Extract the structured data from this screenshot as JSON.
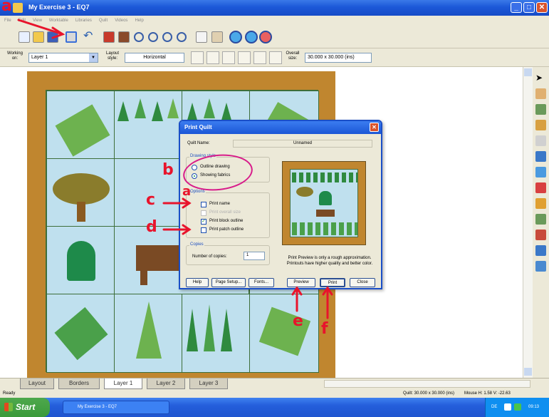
{
  "window": {
    "title": "My Exercise 3 - EQ7",
    "minimize": "_",
    "maximize": "□",
    "close": "✕"
  },
  "menu": [
    "File",
    "Edit",
    "View",
    "Worktable",
    "Libraries",
    "Quilt",
    "Videos",
    "Help"
  ],
  "toolbar2": {
    "working_on_label": "Working on:",
    "working_on_value": "Layer 1",
    "layout_style_label": "Layout style:",
    "layout_style_value": "Horizontal",
    "overall_size_label": "Overall size:",
    "overall_size_value": "30.000 x 30.000 (ins)"
  },
  "tabs": [
    "Layout",
    "Borders",
    "Layer 1",
    "Layer 2",
    "Layer 3"
  ],
  "active_tab": "Layer 1",
  "status": {
    "left": "Ready",
    "quilt": "Quilt: 30.000 x 30.000 (ins)",
    "mouse": "Mouse  H: 1.58  V: -22.63"
  },
  "taskbar": {
    "start": "Start",
    "task": "My Exercise 3 - EQ7",
    "lang": "DE",
    "clock": "09:13"
  },
  "dialog": {
    "title": "Print Quilt",
    "quilt_name_label": "Quilt Name:",
    "quilt_name_value": "Unnamed",
    "drawing_style": {
      "title": "Drawing style",
      "options": [
        "Outline drawing",
        "Showing fabrics"
      ],
      "selected": "Showing fabrics"
    },
    "options": {
      "title": "Options",
      "items": [
        {
          "label": "Print name",
          "checked": false,
          "enabled": true
        },
        {
          "label": "Print overall size",
          "checked": false,
          "enabled": false
        },
        {
          "label": "Print block outline",
          "checked": true,
          "enabled": true
        },
        {
          "label": "Print patch outline",
          "checked": false,
          "enabled": true
        }
      ]
    },
    "copies": {
      "title": "Copies",
      "label": "Number of copies:",
      "value": "1"
    },
    "preview_note": "Print Preview is only a rough approximation. Printouts have higher quality and better color.",
    "buttons": [
      "Help",
      "Page Setup...",
      "Fonts...",
      "Preview",
      "Print",
      "Close"
    ]
  },
  "annotations": [
    "a",
    "b",
    "c",
    "d",
    "e",
    "f"
  ],
  "colors": {
    "quilt_border": "#c0862f",
    "sky": "#bfe0ee",
    "tree": "#2f8a3f",
    "annotation": "#e8142c",
    "ellipse": "#d81b8a"
  }
}
